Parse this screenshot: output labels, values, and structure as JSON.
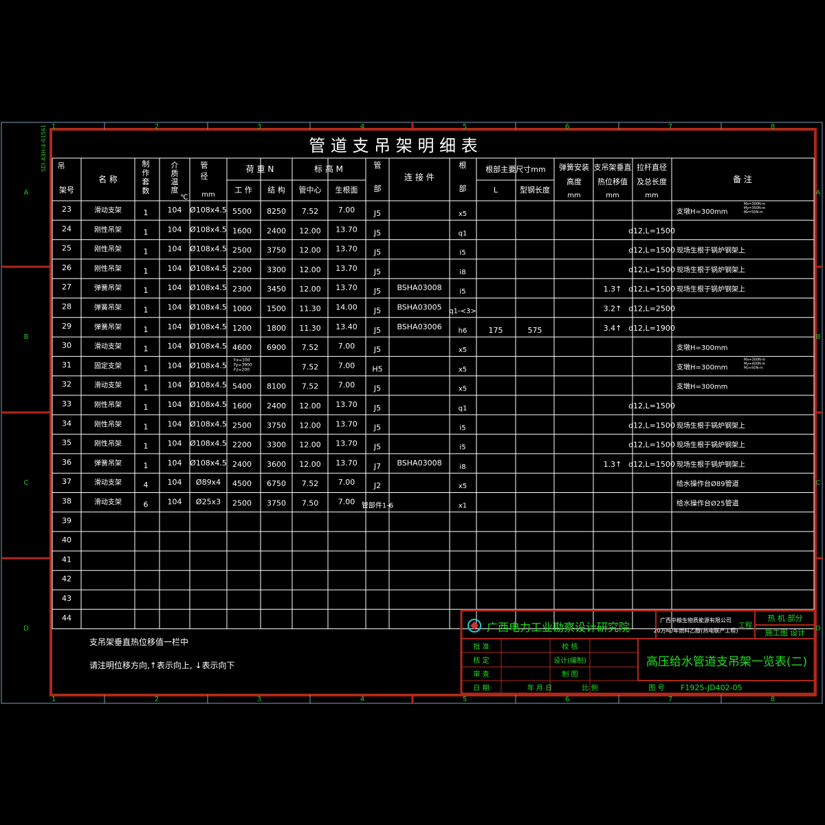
{
  "sheet": {
    "title": "管 道 支 吊 架 明 细 表",
    "side_note": "SDI A3H-4-01561",
    "zone_columns": [
      "1",
      "2",
      "3",
      "4",
      "5",
      "6",
      "7",
      "8"
    ],
    "zone_rows": [
      "A",
      "B",
      "C",
      "D"
    ]
  },
  "table": {
    "headers": {
      "no": "吊架号",
      "name": "名 称",
      "qty": "制作套数",
      "temp": "介质温度℃",
      "pipe": "管径",
      "pipe_unit": "mm",
      "load": "荷 重 N",
      "load_work": "工 作",
      "load_struct": "结 构",
      "elev": "标 高 M",
      "elev_center": "管中心",
      "elev_root": "生根面",
      "pipe_part": "管部",
      "connector": "连 接 件",
      "root_part": "根部",
      "root_dims": "根部主要尺寸mm",
      "root_L": "L",
      "root_steel": "型钢长度",
      "spring_h": "弹簧安装高度",
      "spring_h_unit": "mm",
      "disp": "支吊架垂直热位移值",
      "disp_unit": "mm",
      "rod": "拉杆直径及总长度",
      "rod_unit": "mm",
      "remarks": "备 注"
    },
    "rows": [
      {
        "no": "23",
        "name": "滑动支架",
        "qty": "1",
        "temp": "104",
        "pipe": "Ø108x4.5",
        "work": "5500",
        "struct": "8250",
        "center": "7.52",
        "root": "7.00",
        "pp": "J5",
        "conn": "",
        "rp": "x5",
        "L": "",
        "steel": "",
        "sh": "",
        "disp": "",
        "rod": "",
        "remark": "支墩H=300mm",
        "remark_small": [
          "Mx=300N·m",
          "My=350N·m",
          "Mz=50N·m"
        ]
      },
      {
        "no": "24",
        "name": "刚性吊架",
        "qty": "1",
        "temp": "104",
        "pipe": "Ø108x4.5",
        "work": "1600",
        "struct": "2400",
        "center": "12.00",
        "root": "13.70",
        "pp": "J5",
        "conn": "",
        "rp": "q1",
        "L": "",
        "steel": "",
        "sh": "",
        "disp": "",
        "rod": "d12,L=1500",
        "remark": "",
        "remark_small": []
      },
      {
        "no": "25",
        "name": "刚性吊架",
        "qty": "1",
        "temp": "104",
        "pipe": "Ø108x4.5",
        "work": "2500",
        "struct": "3750",
        "center": "12.00",
        "root": "13.70",
        "pp": "J5",
        "conn": "",
        "rp": "i5",
        "L": "",
        "steel": "",
        "sh": "",
        "disp": "",
        "rod": "d12,L=1500",
        "remark": "现场生根于锅炉钢架上",
        "remark_small": []
      },
      {
        "no": "26",
        "name": "刚性吊架",
        "qty": "1",
        "temp": "104",
        "pipe": "Ø108x4.5",
        "work": "2200",
        "struct": "3300",
        "center": "12.00",
        "root": "13.70",
        "pp": "J5",
        "conn": "",
        "rp": "i8",
        "L": "",
        "steel": "",
        "sh": "",
        "disp": "",
        "rod": "d12,L=1500",
        "remark": "现场生根于锅炉钢架上",
        "remark_small": []
      },
      {
        "no": "27",
        "name": "弹簧吊架",
        "qty": "1",
        "temp": "104",
        "pipe": "Ø108x4.5",
        "work": "2300",
        "struct": "3450",
        "center": "12.00",
        "root": "13.70",
        "pp": "J5",
        "conn": "BSHA03008",
        "rp": "i5",
        "L": "",
        "steel": "",
        "sh": "",
        "disp": "1.3↑",
        "rod": "d12,L=1500",
        "remark": "现场生根于锅炉钢架上",
        "remark_small": []
      },
      {
        "no": "28",
        "name": "弹簧吊架",
        "qty": "1",
        "temp": "104",
        "pipe": "Ø108x4.5",
        "work": "1000",
        "struct": "1500",
        "center": "11.30",
        "root": "14.00",
        "pp": "J5",
        "conn": "BSHA03005",
        "rp": "q1-<3>",
        "L": "",
        "steel": "",
        "sh": "",
        "disp": "3.2↑",
        "rod": "d12,L=2500",
        "remark": "",
        "remark_small": []
      },
      {
        "no": "29",
        "name": "弹簧吊架",
        "qty": "1",
        "temp": "104",
        "pipe": "Ø108x4.5",
        "work": "1200",
        "struct": "1800",
        "center": "11.30",
        "root": "13.40",
        "pp": "J5",
        "conn": "BSHA03006",
        "rp": "h6",
        "L": "175",
        "steel": "575",
        "sh": "",
        "disp": "3.4↑",
        "rod": "d12,L=1900",
        "remark": "",
        "remark_small": []
      },
      {
        "no": "30",
        "name": "滑动支架",
        "qty": "1",
        "temp": "104",
        "pipe": "Ø108x4.5",
        "work": "4600",
        "struct": "6900",
        "center": "7.52",
        "root": "7.00",
        "pp": "J5",
        "conn": "",
        "rp": "x5",
        "L": "",
        "steel": "",
        "sh": "",
        "disp": "",
        "rod": "",
        "remark": "支墩H=300mm",
        "remark_small": []
      },
      {
        "no": "31",
        "name": "固定支架",
        "qty": "1",
        "temp": "104",
        "pipe": "Ø108x4.5",
        "work": "",
        "struct": "",
        "work_small": [
          "Fx=100",
          "Fy=3900",
          "Fz=200"
        ],
        "center": "7.52",
        "root": "7.00",
        "pp": "H5",
        "conn": "",
        "rp": "x5",
        "L": "",
        "steel": "",
        "sh": "",
        "disp": "",
        "rod": "",
        "remark": "支墩H=300mm",
        "remark_small": [
          "Mx=300N·m",
          "My=400N·m",
          "Mz=50N·m"
        ]
      },
      {
        "no": "32",
        "name": "滑动支架",
        "qty": "1",
        "temp": "104",
        "pipe": "Ø108x4.5",
        "work": "5400",
        "struct": "8100",
        "center": "7.52",
        "root": "7.00",
        "pp": "J5",
        "conn": "",
        "rp": "x5",
        "L": "",
        "steel": "",
        "sh": "",
        "disp": "",
        "rod": "",
        "remark": "支墩H=300mm",
        "remark_small": []
      },
      {
        "no": "33",
        "name": "刚性吊架",
        "qty": "1",
        "temp": "104",
        "pipe": "Ø108x4.5",
        "work": "1600",
        "struct": "2400",
        "center": "12.00",
        "root": "13.70",
        "pp": "J5",
        "conn": "",
        "rp": "q1",
        "L": "",
        "steel": "",
        "sh": "",
        "disp": "",
        "rod": "d12,L=1500",
        "remark": "",
        "remark_small": []
      },
      {
        "no": "34",
        "name": "刚性吊架",
        "qty": "1",
        "temp": "104",
        "pipe": "Ø108x4.5",
        "work": "2500",
        "struct": "3750",
        "center": "12.00",
        "root": "13.70",
        "pp": "J5",
        "conn": "",
        "rp": "i5",
        "L": "",
        "steel": "",
        "sh": "",
        "disp": "",
        "rod": "d12,L=1500",
        "remark": "现场生根于锅炉钢架上",
        "remark_small": []
      },
      {
        "no": "35",
        "name": "刚性吊架",
        "qty": "1",
        "temp": "104",
        "pipe": "Ø108x4.5",
        "work": "2200",
        "struct": "3300",
        "center": "12.00",
        "root": "13.70",
        "pp": "J5",
        "conn": "",
        "rp": "i5",
        "L": "",
        "steel": "",
        "sh": "",
        "disp": "",
        "rod": "d12,L=1500",
        "remark": "现场生根于锅炉钢架上",
        "remark_small": []
      },
      {
        "no": "36",
        "name": "弹簧吊架",
        "qty": "1",
        "temp": "104",
        "pipe": "Ø108x4.5",
        "work": "2400",
        "struct": "3600",
        "center": "12.00",
        "root": "13.70",
        "pp": "J7",
        "conn": "BSHA03008",
        "rp": "i8",
        "L": "",
        "steel": "",
        "sh": "",
        "disp": "1.3↑",
        "rod": "d12,L=1500",
        "remark": "现场生根于锅炉钢架上",
        "remark_small": []
      },
      {
        "no": "37",
        "name": "滑动支架",
        "qty": "4",
        "temp": "104",
        "pipe": "Ø89x4",
        "work": "4500",
        "struct": "6750",
        "center": "7.52",
        "root": "7.00",
        "pp": "J2",
        "conn": "",
        "rp": "x5",
        "L": "",
        "steel": "",
        "sh": "",
        "disp": "",
        "rod": "",
        "remark": "给水操作台Ø89管道",
        "remark_small": []
      },
      {
        "no": "38",
        "name": "滑动支架",
        "qty": "6",
        "temp": "104",
        "pipe": "Ø25x3",
        "work": "2500",
        "struct": "3750",
        "center": "7.50",
        "root": "7.00",
        "pp": "管部件1-6",
        "conn": "",
        "rp": "x1",
        "L": "",
        "steel": "",
        "sh": "",
        "disp": "",
        "rod": "",
        "remark": "给水操作台Ø25管道",
        "remark_small": []
      },
      {
        "no": "39"
      },
      {
        "no": "40"
      },
      {
        "no": "41"
      },
      {
        "no": "42"
      },
      {
        "no": "43"
      },
      {
        "no": "44"
      }
    ]
  },
  "notes": [
    "支吊架垂直热位移值一栏中",
    "请注明位移方向,↑表示向上, ↓表示向下"
  ],
  "title_block": {
    "institute": "广西电力工业勘察设计研究院",
    "client_line1": "广西中粮生物质能源有限公司",
    "client_line2": "20万吨/年燃料乙醇(热电联产工程)",
    "project_label": "工程",
    "dept1": "热 机   部分",
    "dept2": "施工图   设计",
    "labels": [
      "批 准",
      "核 定",
      "审 查",
      "日 期"
    ],
    "labels2": [
      "校 核",
      "设计(编制)",
      "制 图"
    ],
    "date_parts": "年 月 日",
    "scale_label": "比 例",
    "drawing_title": "高压给水管道支吊架一览表(二)",
    "drawing_no_label": "图   号",
    "drawing_no": "F1925-JD402-05"
  },
  "colors": {
    "frame": "#b0281a",
    "grid": "#ffffff",
    "text": "#ffffff",
    "green": "#22cc22",
    "cyan": "#22cccc",
    "title_block_text": "#22dd22"
  }
}
